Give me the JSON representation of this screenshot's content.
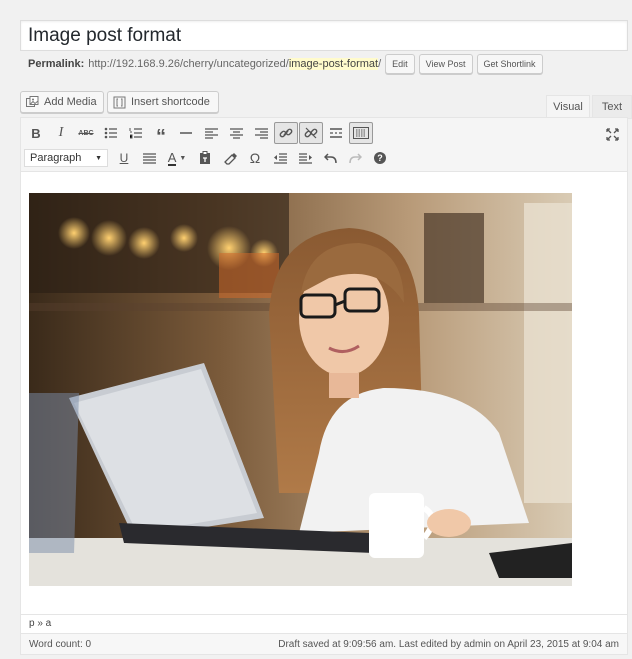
{
  "post_title": "Image post format",
  "permalink": {
    "label": "Permalink:",
    "base": "http://192.168.9.26/cherry/uncategorized/",
    "slug": "image-post-format",
    "trailing": "/",
    "edit_label": "Edit",
    "view_label": "View Post",
    "shortlink_label": "Get Shortlink"
  },
  "media_buttons": {
    "add_media": "Add Media",
    "insert_shortcode": "Insert shortcode"
  },
  "editor_tabs": {
    "visual": "Visual",
    "text": "Text",
    "active": "visual"
  },
  "toolbar": {
    "row1": [
      "bold-icon",
      "italic-icon",
      "strikethrough-icon",
      "bulleted-list-icon",
      "numbered-list-icon",
      "blockquote-icon",
      "horizontal-rule-icon",
      "align-left-icon",
      "align-center-icon",
      "align-right-icon",
      "insert-link-icon",
      "remove-link-icon",
      "read-more-icon",
      "toolbar-toggle-icon"
    ],
    "row2": [
      "underline-icon",
      "justify-icon",
      "text-color-icon",
      "paste-as-text-icon",
      "clear-formatting-icon",
      "special-character-icon",
      "outdent-icon",
      "indent-icon",
      "undo-icon",
      "redo-icon",
      "help-icon"
    ],
    "bold_glyph": "B",
    "italic_glyph": "I",
    "strike_glyph": "ABC",
    "underline_glyph": "U",
    "color_glyph": "A",
    "omega_glyph": "Ω",
    "help_glyph": "?",
    "format_select": "Paragraph"
  },
  "status_path": "p » a",
  "footer": {
    "word_count": "Word count: 0",
    "draft_status": "Draft saved at 9:09:56 am. Last edited by admin on April 23, 2015 at 9:04 am"
  }
}
